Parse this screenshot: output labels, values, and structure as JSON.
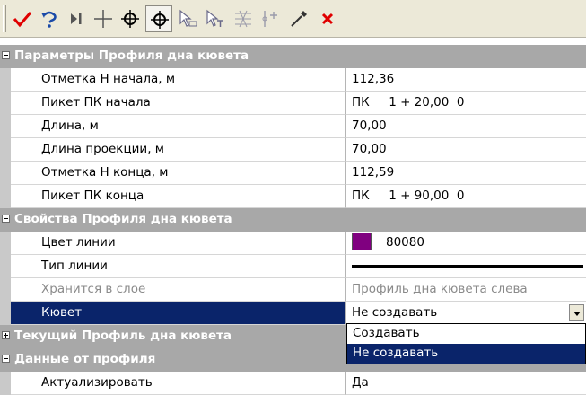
{
  "toolbar": {
    "buttons": [
      {
        "name": "apply-check-icon",
        "color": "#e00000"
      },
      {
        "name": "undo-arrow-icon",
        "color": "#1a4aa8"
      },
      {
        "name": "step-end-icon",
        "color": "#555555"
      },
      {
        "name": "crosshair-plus-icon",
        "color": "#555555"
      },
      {
        "name": "target-circle-icon",
        "color": "#000000"
      },
      {
        "name": "target-circle-pressed-icon",
        "color": "#000000"
      },
      {
        "name": "select-object-icon",
        "color": "#6a6a8a"
      },
      {
        "name": "select-text-icon",
        "color": "#6a6a8a"
      },
      {
        "name": "snap-grid-icon",
        "color": "#9a9aaa"
      },
      {
        "name": "dimension-icon",
        "color": "#9a9aaa"
      },
      {
        "name": "pipette-icon",
        "color": "#333333"
      },
      {
        "name": "close-icon",
        "color": "#e00000"
      }
    ]
  },
  "sections": {
    "s1": {
      "title": "Параметры Профиля дна кювета",
      "rows": [
        {
          "label": "Отметка Н начала, м",
          "value": "112,36"
        },
        {
          "label": "Пикет ПК начала",
          "value": "ПК     1 + 20,00  0"
        },
        {
          "label": "Длина, м",
          "value": "70,00"
        },
        {
          "label": "Длина проекции, м",
          "value": "70,00"
        },
        {
          "label": "Отметка Н конца, м",
          "value": "112,59"
        },
        {
          "label": "Пикет ПК конца",
          "value": "ПК     1 + 90,00  0"
        }
      ]
    },
    "s2": {
      "title": "Свойства Профиля дна кювета",
      "rows": [
        {
          "label": "Цвет линии",
          "value": "80080",
          "color": "#800080"
        },
        {
          "label": "Тип линии",
          "value": ""
        },
        {
          "label": "Хранится в слое",
          "value": "Профиль дна кювета слева"
        },
        {
          "label": "Кювет",
          "value": "Не создавать"
        }
      ]
    },
    "s3": {
      "title": "Текущий Профиль дна кювета"
    },
    "s4": {
      "title": "Данные от профиля",
      "rows": [
        {
          "label": "Актуализировать",
          "value": "Да"
        }
      ]
    }
  },
  "dropdown": {
    "options": [
      "Создавать",
      "Не создавать"
    ],
    "selected": "Не создавать"
  },
  "colors": {
    "category_bg": "#a8a8a8",
    "selection": "#0a246a",
    "toolbar_bg": "#ece9d8"
  }
}
